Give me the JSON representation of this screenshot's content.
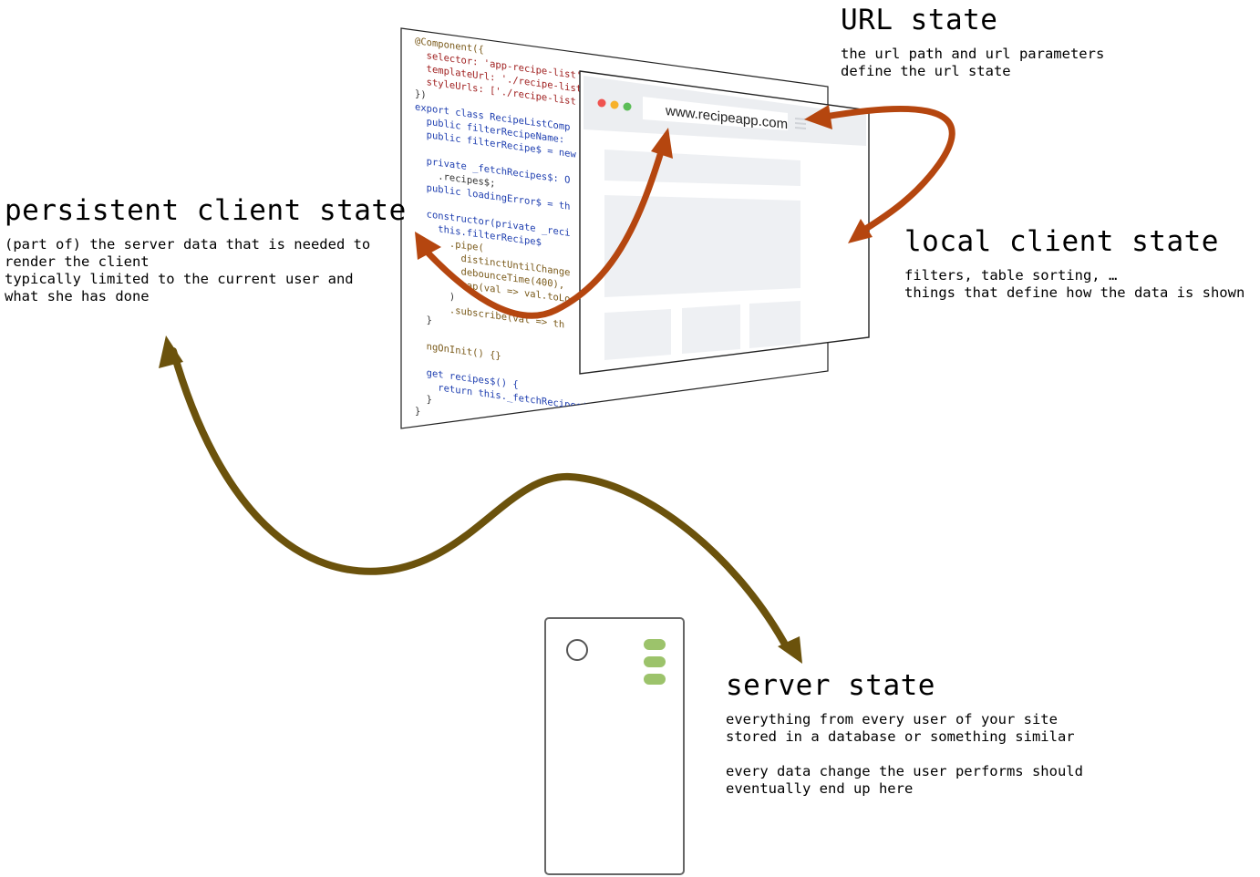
{
  "url_state": {
    "title": "URL state",
    "description": "the url path and url parameters\ndefine the url state"
  },
  "persistent_client_state": {
    "title": "persistent client state",
    "description": "(part of) the server data that is needed to\nrender the client\ntypically limited to the current user and\nwhat she has done"
  },
  "local_client_state": {
    "title": "local client state",
    "description": "filters, table sorting, …\nthings that define how the data is shown"
  },
  "server_state": {
    "title": "server state",
    "description": "everything from every user of your site\nstored in a database or something similar\n\nevery data change the user performs should\neventually end up here"
  },
  "browser": {
    "url": "www.recipeapp.com"
  },
  "code_lines": [
    "@Component({",
    "  selector: 'app-recipe-list',",
    "  templateUrl: './recipe-list",
    "  styleUrls: ['./recipe-list",
    "})",
    "export class RecipeListComp",
    "  public filterRecipeName:",
    "  public filterRecipe$ = new",
    "",
    "  private _fetchRecipes$: O",
    "    .recipes$;",
    "  public loadingError$ = th",
    "",
    "  constructor(private _reci",
    "    this.filterRecipe$",
    "      .pipe(",
    "        distinctUntilChange",
    "        debounceTime(400),",
    "        map(val => val.toLo",
    "      )",
    "      .subscribe(val => th",
    "  }",
    "",
    "  ngOnInit() {}",
    "",
    "  get recipes$() {",
    "    return this._fetchRecipes$;",
    "  }",
    "}"
  ],
  "colors": {
    "orange_arrow": "#b5460f",
    "brown_arrow": "#6b520c",
    "server_led": "#9cc36b"
  }
}
